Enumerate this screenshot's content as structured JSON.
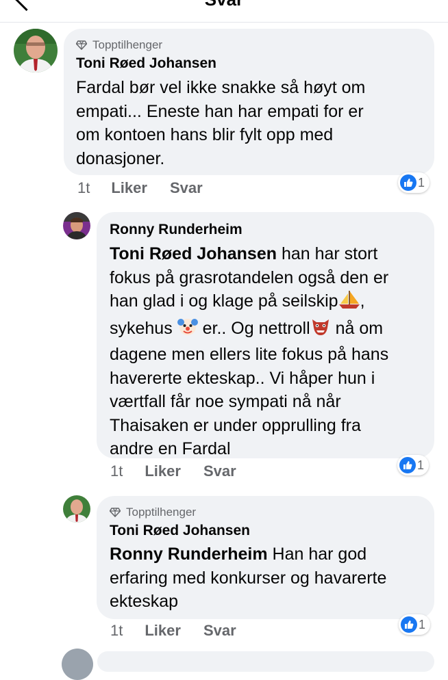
{
  "header": {
    "title": "Svar"
  },
  "comments": [
    {
      "badge": "Topptilhenger",
      "author": "Toni Røed Johansen",
      "mention": "",
      "text_parts": [
        "Fardal bør vel ikke snakke så høyt om",
        "empati... Eneste han har empati for er",
        "om kontoen hans blir fylt opp med",
        "donasjoner."
      ],
      "time": "1t",
      "like_label": "Liker",
      "reply_label": "Svar",
      "reaction_count": "1"
    },
    {
      "badge": "",
      "author": "Ronny Runderheim",
      "mention": "Toni Røed Johansen",
      "text_parts": {
        "l1_rest": " han har stort",
        "l2": "fokus på grasrotandelen også den er",
        "l3": "han glad i og klage på seilskip",
        "l4a": "sykehus ",
        "l4b": " er.. Og nettroll",
        "l4c": " nå om",
        "l5": "dagene men ellers lite fokus på hans",
        "l6": "havererte ekteskap.. Vi håper hun i",
        "l7": "værtfall får noe sympati nå når",
        "l8": "Thaisaken er under opprulling fra",
        "l9": "andre en Fardal"
      },
      "time": "1t",
      "like_label": "Liker",
      "reply_label": "Svar",
      "reaction_count": "1"
    },
    {
      "badge": "Topptilhenger",
      "author": "Toni Røed Johansen",
      "mention": "Ronny Runderheim",
      "text_parts": {
        "l1_rest": " Han har god",
        "l2": "erfaring med konkurser og havarerte",
        "l3": "ekteskap"
      },
      "time": "1t",
      "like_label": "Liker",
      "reply_label": "Svar",
      "reaction_count": "1"
    }
  ],
  "icons": {
    "badge": "diamond-icon",
    "reaction": "like-reaction-icon",
    "emoji_1": "sailboat-emoji",
    "emoji_2": "clown-emoji",
    "emoji_3": "goblin-emoji"
  },
  "colors": {
    "bubble": "#f0f2f5",
    "text": "#050505",
    "secondary": "#65676b",
    "like_blue": "#1877f2"
  }
}
